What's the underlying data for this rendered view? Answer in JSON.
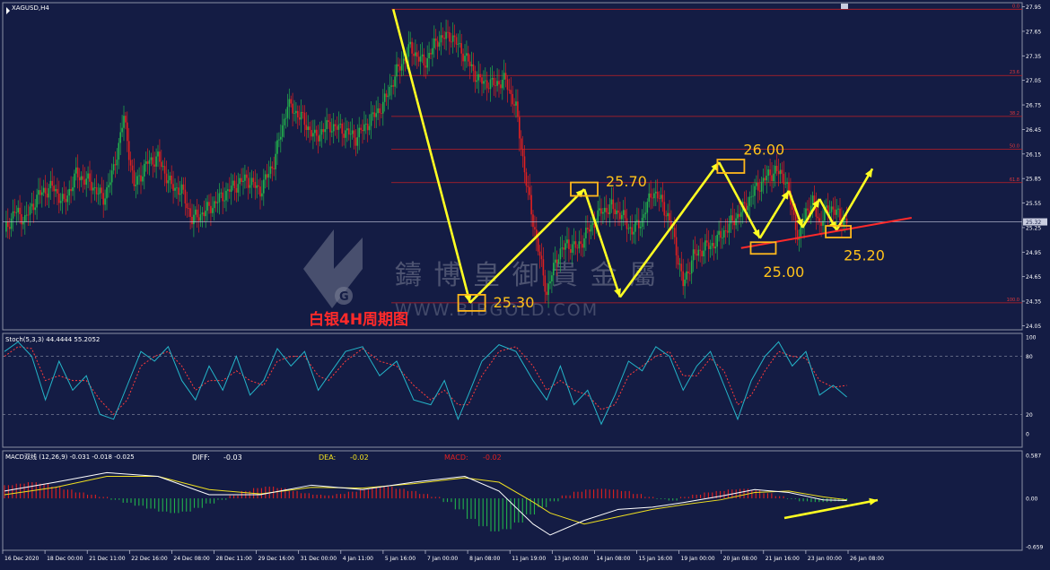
{
  "window": {
    "symbol_title": "XAGUSD,H4"
  },
  "caption": "白银4H周期图",
  "watermark": {
    "cn": "鑄 博 皇 御 貴 金 屬",
    "url": "WWW.BIBGOLD.COM"
  },
  "colors": {
    "background": "#141c44",
    "bull": "#22b14c",
    "bear": "#e02020",
    "fib": "#c21f25",
    "arrow": "#ffff22",
    "box": "#ffb81c",
    "label": "#ffc21a",
    "stoch_main": "#24b5c9",
    "stoch_signal": "#ff3b3b",
    "macd_diff": "#ffffff",
    "macd_dea": "#f0e020",
    "trendline": "#ff2a2a"
  },
  "price_axis": {
    "ticks": [
      "27.95",
      "27.65",
      "27.35",
      "27.05",
      "26.75",
      "26.45",
      "26.15",
      "25.85",
      "25.55",
      "25.25",
      "24.95",
      "24.65",
      "24.35",
      "24.05"
    ],
    "current": "25.32"
  },
  "fib_levels": [
    {
      "label": "0.0",
      "value": 27.92
    },
    {
      "label": "23.6",
      "value": 27.11
    },
    {
      "label": "38.2",
      "value": 26.61
    },
    {
      "label": "50.0",
      "value": 26.21
    },
    {
      "label": "61.8",
      "value": 25.8
    },
    {
      "label": "100.0",
      "value": 24.33
    }
  ],
  "annotations": [
    "25.30",
    "25.70",
    "26.00",
    "25.00",
    "25.20"
  ],
  "stoch": {
    "title": "Stoch(5,3,3) 44.4444 55.2052",
    "levels": [
      "100",
      "80",
      "20",
      "0"
    ]
  },
  "macd": {
    "title": "MACD双线 (12,26,9) -0.031 -0.018 -0.025",
    "diff_label": "DIFF:",
    "diff_value": "-0.03",
    "dea_label": "DEA:",
    "dea_value": "-0.02",
    "macd_label": "MACD:",
    "macd_value": "-0.02",
    "levels": [
      "0.587",
      "0.00",
      "-0.659"
    ]
  },
  "time_axis": [
    "16 Dec 2020",
    "18 Dec 00:00",
    "21 Dec 11:00",
    "22 Dec 16:00",
    "24 Dec 08:00",
    "28 Dec 11:00",
    "29 Dec 16:00",
    "31 Dec 00:00",
    "4 Jan 11:00",
    "5 Jan 16:00",
    "7 Jan 00:00",
    "8 Jan 08:00",
    "11 Jan 19:00",
    "13 Jan 00:00",
    "14 Jan 08:00",
    "15 Jan 16:00",
    "19 Jan 00:00",
    "20 Jan 08:00",
    "21 Jan 16:00",
    "23 Jan 00:00",
    "26 Jan 08:00"
  ],
  "chart_data": {
    "type": "candlestick",
    "title": "XAGUSD,H4",
    "x_labels": [
      "16 Dec 2020",
      "18 Dec 00:00",
      "21 Dec 11:00",
      "22 Dec 16:00",
      "24 Dec 08:00",
      "28 Dec 11:00",
      "29 Dec 16:00",
      "31 Dec 00:00",
      "4 Jan 11:00",
      "5 Jan 16:00",
      "7 Jan 00:00",
      "8 Jan 08:00",
      "11 Jan 19:00",
      "13 Jan 00:00",
      "14 Jan 08:00",
      "15 Jan 16:00",
      "19 Jan 00:00",
      "20 Jan 08:00",
      "21 Jan 16:00",
      "23 Jan 00:00",
      "26 Jan 08:00"
    ],
    "ylim": [
      24.0,
      28.0
    ],
    "close_path": [
      [
        0,
        25.2
      ],
      [
        6,
        25.45
      ],
      [
        12,
        25.35
      ],
      [
        20,
        25.65
      ],
      [
        28,
        25.75
      ],
      [
        35,
        25.55
      ],
      [
        42,
        25.9
      ],
      [
        50,
        25.8
      ],
      [
        58,
        25.6
      ],
      [
        64,
        25.95
      ],
      [
        70,
        26.6
      ],
      [
        76,
        25.75
      ],
      [
        84,
        26.05
      ],
      [
        90,
        26.1
      ],
      [
        98,
        25.75
      ],
      [
        104,
        25.7
      ],
      [
        110,
        25.35
      ],
      [
        118,
        25.45
      ],
      [
        126,
        25.6
      ],
      [
        134,
        25.75
      ],
      [
        142,
        25.85
      ],
      [
        150,
        25.7
      ],
      [
        158,
        26.05
      ],
      [
        166,
        26.75
      ],
      [
        174,
        26.6
      ],
      [
        182,
        26.35
      ],
      [
        190,
        26.5
      ],
      [
        198,
        26.45
      ],
      [
        206,
        26.35
      ],
      [
        214,
        26.55
      ],
      [
        222,
        26.75
      ],
      [
        230,
        27.15
      ],
      [
        238,
        27.45
      ],
      [
        246,
        27.25
      ],
      [
        254,
        27.55
      ],
      [
        262,
        27.6
      ],
      [
        270,
        27.35
      ],
      [
        278,
        27.05
      ],
      [
        286,
        27.0
      ],
      [
        294,
        27.05
      ],
      [
        300,
        26.7
      ],
      [
        306,
        25.8
      ],
      [
        312,
        25.1
      ],
      [
        318,
        24.45
      ],
      [
        324,
        24.9
      ],
      [
        330,
        25.05
      ],
      [
        336,
        25.0
      ],
      [
        342,
        25.2
      ],
      [
        350,
        25.45
      ],
      [
        356,
        25.5
      ],
      [
        362,
        25.4
      ],
      [
        368,
        25.2
      ],
      [
        374,
        25.35
      ],
      [
        380,
        25.7
      ],
      [
        386,
        25.55
      ],
      [
        392,
        25.2
      ],
      [
        398,
        24.55
      ],
      [
        404,
        24.9
      ],
      [
        410,
        25.0
      ],
      [
        416,
        25.05
      ],
      [
        422,
        25.2
      ],
      [
        428,
        25.35
      ],
      [
        434,
        25.5
      ],
      [
        440,
        25.7
      ],
      [
        446,
        25.85
      ],
      [
        452,
        25.95
      ],
      [
        458,
        25.85
      ],
      [
        462,
        25.45
      ],
      [
        466,
        25.1
      ],
      [
        470,
        25.45
      ],
      [
        474,
        25.55
      ],
      [
        478,
        25.3
      ],
      [
        482,
        25.45
      ],
      [
        486,
        25.5
      ],
      [
        490,
        25.35
      ],
      [
        494,
        25.35
      ]
    ],
    "fib_levels": {
      "0.0": 27.92,
      "23.6": 27.11,
      "38.2": 26.61,
      "50.0": 26.21,
      "61.8": 25.8,
      "100.0": 24.33
    },
    "annotations": {
      "25.30": 25.3,
      "25.70": 25.7,
      "26.00": 26.0,
      "25.00": 25.0,
      "25.20": 25.2
    },
    "current_price": 25.32,
    "indicators": {
      "stoch": {
        "params": "5,3,3",
        "main": 44.4444,
        "signal": 55.2052,
        "levels": [
          80,
          20
        ],
        "range": [
          0,
          100
        ],
        "main_path": [
          [
            0,
            85
          ],
          [
            8,
            95
          ],
          [
            16,
            80
          ],
          [
            24,
            35
          ],
          [
            32,
            75
          ],
          [
            40,
            45
          ],
          [
            48,
            60
          ],
          [
            56,
            20
          ],
          [
            64,
            15
          ],
          [
            72,
            50
          ],
          [
            80,
            85
          ],
          [
            88,
            75
          ],
          [
            96,
            90
          ],
          [
            104,
            55
          ],
          [
            112,
            35
          ],
          [
            120,
            70
          ],
          [
            128,
            45
          ],
          [
            136,
            80
          ],
          [
            144,
            40
          ],
          [
            152,
            55
          ],
          [
            160,
            88
          ],
          [
            168,
            70
          ],
          [
            176,
            85
          ],
          [
            184,
            45
          ],
          [
            190,
            60
          ],
          [
            200,
            85
          ],
          [
            210,
            90
          ],
          [
            220,
            60
          ],
          [
            230,
            75
          ],
          [
            240,
            35
          ],
          [
            250,
            30
          ],
          [
            258,
            55
          ],
          [
            266,
            15
          ],
          [
            272,
            40
          ],
          [
            280,
            75
          ],
          [
            290,
            92
          ],
          [
            300,
            85
          ],
          [
            310,
            55
          ],
          [
            318,
            35
          ],
          [
            326,
            70
          ],
          [
            334,
            30
          ],
          [
            342,
            45
          ],
          [
            350,
            10
          ],
          [
            358,
            40
          ],
          [
            366,
            75
          ],
          [
            374,
            65
          ],
          [
            382,
            90
          ],
          [
            390,
            80
          ],
          [
            398,
            45
          ],
          [
            406,
            70
          ],
          [
            414,
            85
          ],
          [
            422,
            50
          ],
          [
            430,
            15
          ],
          [
            438,
            55
          ],
          [
            446,
            80
          ],
          [
            454,
            95
          ],
          [
            462,
            70
          ],
          [
            470,
            85
          ],
          [
            478,
            40
          ],
          [
            486,
            50
          ],
          [
            494,
            38
          ]
        ],
        "signal_path": [
          [
            0,
            80
          ],
          [
            8,
            90
          ],
          [
            16,
            88
          ],
          [
            24,
            55
          ],
          [
            32,
            60
          ],
          [
            40,
            55
          ],
          [
            48,
            55
          ],
          [
            56,
            35
          ],
          [
            64,
            20
          ],
          [
            72,
            35
          ],
          [
            80,
            70
          ],
          [
            88,
            80
          ],
          [
            96,
            85
          ],
          [
            104,
            70
          ],
          [
            112,
            45
          ],
          [
            120,
            55
          ],
          [
            128,
            55
          ],
          [
            136,
            65
          ],
          [
            144,
            55
          ],
          [
            152,
            50
          ],
          [
            160,
            75
          ],
          [
            168,
            80
          ],
          [
            176,
            80
          ],
          [
            184,
            60
          ],
          [
            190,
            55
          ],
          [
            200,
            75
          ],
          [
            210,
            88
          ],
          [
            220,
            75
          ],
          [
            230,
            70
          ],
          [
            240,
            50
          ],
          [
            250,
            35
          ],
          [
            258,
            45
          ],
          [
            266,
            30
          ],
          [
            272,
            30
          ],
          [
            280,
            60
          ],
          [
            290,
            85
          ],
          [
            300,
            90
          ],
          [
            310,
            70
          ],
          [
            318,
            45
          ],
          [
            326,
            55
          ],
          [
            334,
            45
          ],
          [
            342,
            40
          ],
          [
            350,
            25
          ],
          [
            358,
            30
          ],
          [
            366,
            60
          ],
          [
            374,
            70
          ],
          [
            382,
            80
          ],
          [
            390,
            85
          ],
          [
            398,
            60
          ],
          [
            406,
            60
          ],
          [
            414,
            78
          ],
          [
            422,
            65
          ],
          [
            430,
            30
          ],
          [
            438,
            40
          ],
          [
            446,
            65
          ],
          [
            454,
            85
          ],
          [
            462,
            80
          ],
          [
            470,
            78
          ],
          [
            478,
            55
          ],
          [
            486,
            48
          ],
          [
            494,
            50
          ]
        ]
      },
      "macd": {
        "params": "12,26,9",
        "diff": -0.03,
        "dea": -0.02,
        "macd": -0.02,
        "range": [
          -0.659,
          0.587
        ],
        "hist": [
          0.18,
          0.2,
          0.22,
          0.2,
          0.16,
          0.12,
          0.08,
          0.05,
          0.02,
          -0.02,
          -0.06,
          -0.1,
          -0.14,
          -0.18,
          -0.2,
          -0.18,
          -0.13,
          -0.07,
          -0.02,
          0.04,
          0.1,
          0.14,
          0.16,
          0.14,
          0.1,
          0.07,
          0.05,
          0.04,
          0.06,
          0.09,
          0.12,
          0.15,
          0.16,
          0.13,
          0.1,
          0.06,
          0.02,
          -0.05,
          -0.15,
          -0.28,
          -0.38,
          -0.45,
          -0.42,
          -0.33,
          -0.22,
          -0.12,
          -0.04,
          0.04,
          0.09,
          0.12,
          0.13,
          0.12,
          0.1,
          0.06,
          0.02,
          -0.01,
          -0.03,
          0.02,
          0.05,
          0.08,
          0.1,
          0.12,
          0.13,
          0.11,
          0.07,
          0.03,
          -0.01,
          -0.04,
          -0.05,
          -0.05,
          -0.04,
          -0.03
        ],
        "diff_path": [
          [
            0,
            0.1
          ],
          [
            30,
            0.22
          ],
          [
            60,
            0.35
          ],
          [
            90,
            0.3
          ],
          [
            120,
            0.05
          ],
          [
            150,
            0.05
          ],
          [
            180,
            0.18
          ],
          [
            210,
            0.12
          ],
          [
            240,
            0.22
          ],
          [
            270,
            0.3
          ],
          [
            290,
            0.1
          ],
          [
            310,
            -0.35
          ],
          [
            320,
            -0.5
          ],
          [
            340,
            -0.3
          ],
          [
            360,
            -0.15
          ],
          [
            380,
            -0.12
          ],
          [
            400,
            -0.05
          ],
          [
            420,
            0.03
          ],
          [
            440,
            0.12
          ],
          [
            460,
            0.08
          ],
          [
            480,
            -0.02
          ],
          [
            494,
            -0.03
          ]
        ],
        "dea_path": [
          [
            0,
            0.05
          ],
          [
            30,
            0.15
          ],
          [
            60,
            0.3
          ],
          [
            90,
            0.3
          ],
          [
            120,
            0.12
          ],
          [
            150,
            0.06
          ],
          [
            180,
            0.15
          ],
          [
            210,
            0.14
          ],
          [
            240,
            0.2
          ],
          [
            270,
            0.28
          ],
          [
            290,
            0.22
          ],
          [
            310,
            -0.05
          ],
          [
            320,
            -0.2
          ],
          [
            340,
            -0.35
          ],
          [
            360,
            -0.25
          ],
          [
            380,
            -0.15
          ],
          [
            400,
            -0.08
          ],
          [
            420,
            -0.02
          ],
          [
            440,
            0.08
          ],
          [
            460,
            0.1
          ],
          [
            480,
            0.02
          ],
          [
            494,
            -0.02
          ]
        ]
      }
    }
  }
}
